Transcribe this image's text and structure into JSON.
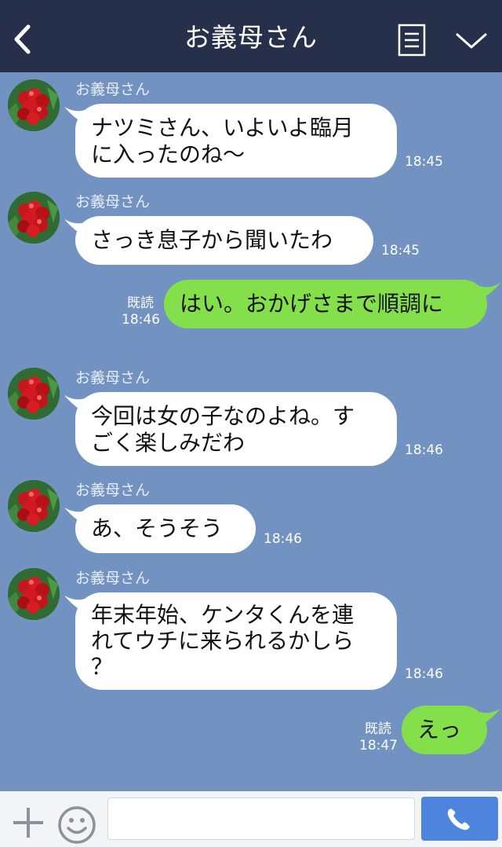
{
  "header": {
    "title": "お義母さん",
    "back_icon": "chevron-left-icon",
    "menu_icon": "note-icon",
    "collapse_icon": "chevron-down-icon"
  },
  "messages": [
    {
      "side": "in",
      "sender": "お義母さん",
      "lines": [
        "ナツミさん、いよいよ臨月",
        "に入ったのね〜"
      ],
      "time": "18:45"
    },
    {
      "side": "in",
      "sender": "お義母さん",
      "lines": [
        "さっき息子から聞いたわ"
      ],
      "time": "18:45"
    },
    {
      "side": "out",
      "read": "既読",
      "lines": [
        "はい。おかげさまで順調に"
      ],
      "time": "18:46"
    },
    {
      "side": "in",
      "sender": "お義母さん",
      "lines": [
        "今回は女の子なのよね。す",
        "ごく楽しみだわ"
      ],
      "time": "18:46"
    },
    {
      "side": "in",
      "sender": "お義母さん",
      "lines": [
        "あ、そうそう"
      ],
      "time": "18:46"
    },
    {
      "side": "in",
      "sender": "お義母さん",
      "lines": [
        "年末年始、ケンタくんを連",
        "れてウチに来られるかしら",
        "？"
      ],
      "time": "18:46"
    },
    {
      "side": "out",
      "read": "既読",
      "lines": [
        "えっ"
      ],
      "time": "18:47"
    }
  ],
  "footer": {
    "input_value": "",
    "input_placeholder": "",
    "plus_icon": "plus-icon",
    "emoji_icon": "smiley-icon",
    "call_icon": "phone-icon"
  },
  "colors": {
    "background": "#7293c1",
    "header": "#27304a",
    "incoming_bubble": "#ffffff",
    "outgoing_bubble": "#83e04a",
    "call_button": "#4e84dd"
  }
}
